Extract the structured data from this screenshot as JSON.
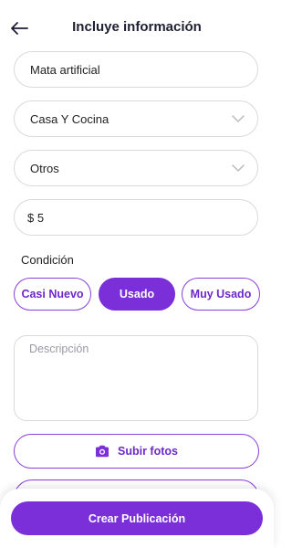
{
  "header": {
    "title": "Incluye información",
    "back_icon": "arrow-left-icon"
  },
  "form": {
    "title_value": "Mata artificial",
    "category_value": "Casa Y Cocina",
    "subcategory_value": "Otros",
    "price_value": "$ 5",
    "condition_label": "Condición",
    "condition_options": [
      "Casi Nuevo",
      "Usado",
      "Muy Usado"
    ],
    "condition_selected": "Usado",
    "description_placeholder": "Descripción",
    "upload_label": "Subir fotos",
    "upload_icon": "camera-icon",
    "submit_label": "Crear Publicación"
  },
  "colors": {
    "accent": "#7a2fd8",
    "border": "#d9d9de",
    "text": "#1f1f33"
  }
}
